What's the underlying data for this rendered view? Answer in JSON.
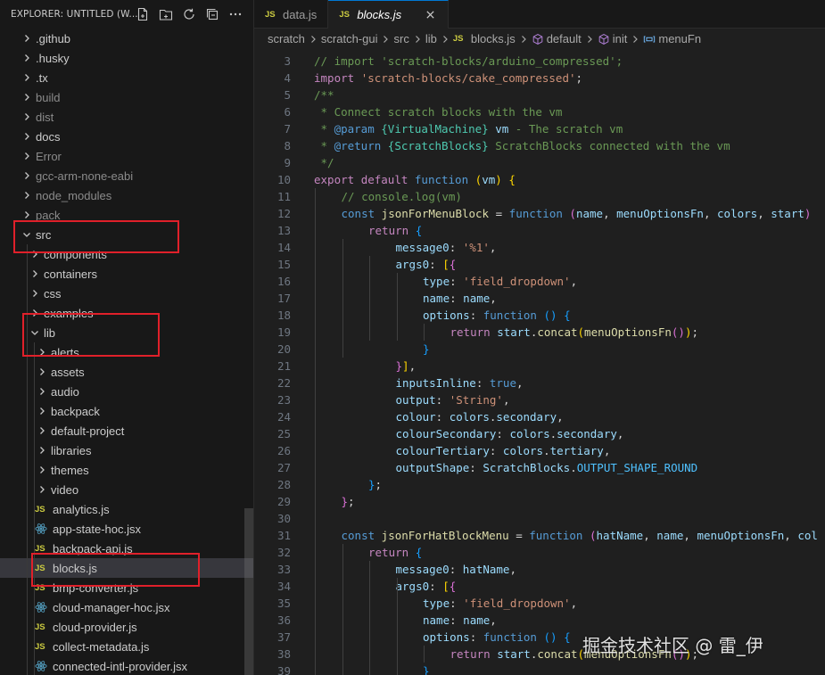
{
  "sidebar": {
    "title": "EXPLORER: UNTITLED (W...",
    "header_icons": [
      "new-file-icon",
      "new-folder-icon",
      "refresh-icon",
      "collapse-all-icon",
      "more-icon"
    ],
    "tree": [
      {
        "label": ".github",
        "type": "folder",
        "expanded": false,
        "dim": false
      },
      {
        "label": ".husky",
        "type": "folder",
        "expanded": false,
        "dim": false
      },
      {
        "label": ".tx",
        "type": "folder",
        "expanded": false,
        "dim": false
      },
      {
        "label": "build",
        "type": "folder",
        "expanded": false,
        "dim": true
      },
      {
        "label": "dist",
        "type": "folder",
        "expanded": false,
        "dim": true
      },
      {
        "label": "docs",
        "type": "folder",
        "expanded": false,
        "dim": false
      },
      {
        "label": "Error",
        "type": "folder",
        "expanded": false,
        "dim": true
      },
      {
        "label": "gcc-arm-none-eabi",
        "type": "folder",
        "expanded": false,
        "dim": true
      },
      {
        "label": "node_modules",
        "type": "folder",
        "expanded": false,
        "dim": true
      },
      {
        "label": "pack",
        "type": "folder",
        "expanded": false,
        "dim": true
      },
      {
        "label": "src",
        "type": "folder",
        "expanded": true,
        "dim": false
      },
      {
        "label": "components",
        "type": "folder",
        "expanded": false,
        "dim": false
      },
      {
        "label": "containers",
        "type": "folder",
        "expanded": false,
        "dim": false
      },
      {
        "label": "css",
        "type": "folder",
        "expanded": false,
        "dim": false
      },
      {
        "label": "examples",
        "type": "folder",
        "expanded": false,
        "dim": false
      },
      {
        "label": "lib",
        "type": "folder",
        "expanded": true,
        "dim": false
      },
      {
        "label": "alerts",
        "type": "folder",
        "expanded": false,
        "dim": false
      },
      {
        "label": "assets",
        "type": "folder",
        "expanded": false,
        "dim": false
      },
      {
        "label": "audio",
        "type": "folder",
        "expanded": false,
        "dim": false
      },
      {
        "label": "backpack",
        "type": "folder",
        "expanded": false,
        "dim": false
      },
      {
        "label": "default-project",
        "type": "folder",
        "expanded": false,
        "dim": false
      },
      {
        "label": "libraries",
        "type": "folder",
        "expanded": false,
        "dim": false
      },
      {
        "label": "themes",
        "type": "folder",
        "expanded": false,
        "dim": false
      },
      {
        "label": "video",
        "type": "folder",
        "expanded": false,
        "dim": false
      },
      {
        "label": "analytics.js",
        "type": "js",
        "dim": false
      },
      {
        "label": "app-state-hoc.jsx",
        "type": "jsx",
        "dim": false
      },
      {
        "label": "backpack-api.js",
        "type": "js",
        "dim": false
      },
      {
        "label": "blocks.js",
        "type": "js",
        "dim": false,
        "selected": true
      },
      {
        "label": "bmp-converter.js",
        "type": "js",
        "dim": false
      },
      {
        "label": "cloud-manager-hoc.jsx",
        "type": "jsx",
        "dim": false
      },
      {
        "label": "cloud-provider.js",
        "type": "js",
        "dim": false
      },
      {
        "label": "collect-metadata.js",
        "type": "js",
        "dim": false
      },
      {
        "label": "connected-intl-provider.jsx",
        "type": "jsx",
        "dim": false
      }
    ]
  },
  "tabs": [
    {
      "label": "data.js",
      "icon": "JS",
      "active": false
    },
    {
      "label": "blocks.js",
      "icon": "JS",
      "active": true
    }
  ],
  "breadcrumb": [
    {
      "label": "scratch",
      "icon": ""
    },
    {
      "label": "scratch-gui",
      "icon": ""
    },
    {
      "label": "src",
      "icon": ""
    },
    {
      "label": "lib",
      "icon": ""
    },
    {
      "label": "blocks.js",
      "icon": "JS"
    },
    {
      "label": "default",
      "icon": "cube-icon"
    },
    {
      "label": "init",
      "icon": "cube-icon"
    },
    {
      "label": "menuFn",
      "icon": "variable-icon"
    }
  ],
  "code": [
    {
      "n": "3",
      "indent": 0,
      "tokens": [
        [
          "com",
          "// import 'scratch-blocks/arduino_compressed';"
        ]
      ]
    },
    {
      "n": "4",
      "indent": 0,
      "tokens": [
        [
          "ctl",
          "import"
        ],
        [
          "pl",
          " "
        ],
        [
          "str",
          "'scratch-blocks/cake_compressed'"
        ],
        [
          "pl",
          ";"
        ]
      ]
    },
    {
      "n": "5",
      "indent": 0,
      "tokens": [
        [
          "com",
          "/**"
        ]
      ]
    },
    {
      "n": "6",
      "indent": 0,
      "tokens": [
        [
          "com",
          " * Connect scratch blocks with the vm"
        ]
      ]
    },
    {
      "n": "7",
      "indent": 0,
      "tokens": [
        [
          "com",
          " * "
        ],
        [
          "kw",
          "@param"
        ],
        [
          "com",
          " "
        ],
        [
          "cls",
          "{VirtualMachine}"
        ],
        [
          "com",
          " "
        ],
        [
          "var",
          "vm"
        ],
        [
          "com",
          " - The scratch vm"
        ]
      ]
    },
    {
      "n": "8",
      "indent": 0,
      "tokens": [
        [
          "com",
          " * "
        ],
        [
          "kw",
          "@return"
        ],
        [
          "com",
          " "
        ],
        [
          "cls",
          "{ScratchBlocks}"
        ],
        [
          "com",
          " ScratchBlocks connected with the vm"
        ]
      ]
    },
    {
      "n": "9",
      "indent": 0,
      "tokens": [
        [
          "com",
          " */"
        ]
      ]
    },
    {
      "n": "10",
      "indent": 0,
      "tokens": [
        [
          "ctl",
          "export"
        ],
        [
          "pl",
          " "
        ],
        [
          "ctl",
          "default"
        ],
        [
          "pl",
          " "
        ],
        [
          "kw",
          "function"
        ],
        [
          "pl",
          " "
        ],
        [
          "br1",
          "("
        ],
        [
          "var",
          "vm"
        ],
        [
          "br1",
          ")"
        ],
        [
          "pl",
          " "
        ],
        [
          "br1",
          "{"
        ]
      ]
    },
    {
      "n": "11",
      "indent": 1,
      "tokens": [
        [
          "com",
          "// console.log(vm)"
        ]
      ]
    },
    {
      "n": "12",
      "indent": 1,
      "tokens": [
        [
          "kw",
          "const"
        ],
        [
          "pl",
          " "
        ],
        [
          "fn",
          "jsonForMenuBlock"
        ],
        [
          "pl",
          " = "
        ],
        [
          "kw",
          "function"
        ],
        [
          "pl",
          " "
        ],
        [
          "br2",
          "("
        ],
        [
          "var",
          "name"
        ],
        [
          "pl",
          ", "
        ],
        [
          "var",
          "menuOptionsFn"
        ],
        [
          "pl",
          ", "
        ],
        [
          "var",
          "colors"
        ],
        [
          "pl",
          ", "
        ],
        [
          "var",
          "start"
        ],
        [
          "br2",
          ")"
        ]
      ]
    },
    {
      "n": "13",
      "indent": 2,
      "tokens": [
        [
          "ctl",
          "return"
        ],
        [
          "pl",
          " "
        ],
        [
          "br3",
          "{"
        ]
      ]
    },
    {
      "n": "14",
      "indent": 3,
      "tokens": [
        [
          "var",
          "message0"
        ],
        [
          "pl",
          ": "
        ],
        [
          "str",
          "'%1'"
        ],
        [
          "pl",
          ","
        ]
      ]
    },
    {
      "n": "15",
      "indent": 3,
      "tokens": [
        [
          "var",
          "args0"
        ],
        [
          "pl",
          ": "
        ],
        [
          "br1",
          "["
        ],
        [
          "br2",
          "{"
        ]
      ]
    },
    {
      "n": "16",
      "indent": 4,
      "tokens": [
        [
          "var",
          "type"
        ],
        [
          "pl",
          ": "
        ],
        [
          "str",
          "'field_dropdown'"
        ],
        [
          "pl",
          ","
        ]
      ]
    },
    {
      "n": "17",
      "indent": 4,
      "tokens": [
        [
          "var",
          "name"
        ],
        [
          "pl",
          ": "
        ],
        [
          "var",
          "name"
        ],
        [
          "pl",
          ","
        ]
      ]
    },
    {
      "n": "18",
      "indent": 4,
      "tokens": [
        [
          "var",
          "options"
        ],
        [
          "pl",
          ": "
        ],
        [
          "kw",
          "function"
        ],
        [
          "pl",
          " "
        ],
        [
          "br3",
          "()"
        ],
        [
          "pl",
          " "
        ],
        [
          "br3",
          "{"
        ]
      ]
    },
    {
      "n": "19",
      "indent": 5,
      "tokens": [
        [
          "ctl",
          "return"
        ],
        [
          "pl",
          " "
        ],
        [
          "var",
          "start"
        ],
        [
          "pl",
          "."
        ],
        [
          "fn",
          "concat"
        ],
        [
          "br1",
          "("
        ],
        [
          "fn",
          "menuOptionsFn"
        ],
        [
          "br2",
          "()"
        ],
        [
          "br1",
          ")"
        ],
        [
          "pl",
          ";"
        ]
      ]
    },
    {
      "n": "20",
      "indent": 4,
      "tokens": [
        [
          "br3",
          "}"
        ]
      ]
    },
    {
      "n": "21",
      "indent": 3,
      "tokens": [
        [
          "br2",
          "}"
        ],
        [
          "br1",
          "]"
        ],
        [
          "pl",
          ","
        ]
      ]
    },
    {
      "n": "22",
      "indent": 3,
      "tokens": [
        [
          "var",
          "inputsInline"
        ],
        [
          "pl",
          ": "
        ],
        [
          "kw",
          "true"
        ],
        [
          "pl",
          ","
        ]
      ]
    },
    {
      "n": "23",
      "indent": 3,
      "tokens": [
        [
          "var",
          "output"
        ],
        [
          "pl",
          ": "
        ],
        [
          "str",
          "'String'"
        ],
        [
          "pl",
          ","
        ]
      ]
    },
    {
      "n": "24",
      "indent": 3,
      "tokens": [
        [
          "var",
          "colour"
        ],
        [
          "pl",
          ": "
        ],
        [
          "var",
          "colors"
        ],
        [
          "pl",
          "."
        ],
        [
          "var",
          "secondary"
        ],
        [
          "pl",
          ","
        ]
      ]
    },
    {
      "n": "25",
      "indent": 3,
      "tokens": [
        [
          "var",
          "colourSecondary"
        ],
        [
          "pl",
          ": "
        ],
        [
          "var",
          "colors"
        ],
        [
          "pl",
          "."
        ],
        [
          "var",
          "secondary"
        ],
        [
          "pl",
          ","
        ]
      ]
    },
    {
      "n": "26",
      "indent": 3,
      "tokens": [
        [
          "var",
          "colourTertiary"
        ],
        [
          "pl",
          ": "
        ],
        [
          "var",
          "colors"
        ],
        [
          "pl",
          "."
        ],
        [
          "var",
          "tertiary"
        ],
        [
          "pl",
          ","
        ]
      ]
    },
    {
      "n": "27",
      "indent": 3,
      "tokens": [
        [
          "var",
          "outputShape"
        ],
        [
          "pl",
          ": "
        ],
        [
          "var",
          "ScratchBlocks"
        ],
        [
          "pl",
          "."
        ],
        [
          "const",
          "OUTPUT_SHAPE_ROUND"
        ]
      ]
    },
    {
      "n": "28",
      "indent": 2,
      "tokens": [
        [
          "br3",
          "}"
        ],
        [
          "pl",
          ";"
        ]
      ]
    },
    {
      "n": "29",
      "indent": 1,
      "tokens": [
        [
          "br2",
          "}"
        ],
        [
          "pl",
          ";"
        ]
      ]
    },
    {
      "n": "30",
      "indent": 0,
      "tokens": []
    },
    {
      "n": "31",
      "indent": 1,
      "tokens": [
        [
          "kw",
          "const"
        ],
        [
          "pl",
          " "
        ],
        [
          "fn",
          "jsonForHatBlockMenu"
        ],
        [
          "pl",
          " = "
        ],
        [
          "kw",
          "function"
        ],
        [
          "pl",
          " "
        ],
        [
          "br2",
          "("
        ],
        [
          "var",
          "hatName"
        ],
        [
          "pl",
          ", "
        ],
        [
          "var",
          "name"
        ],
        [
          "pl",
          ", "
        ],
        [
          "var",
          "menuOptionsFn"
        ],
        [
          "pl",
          ", "
        ],
        [
          "var",
          "col"
        ]
      ]
    },
    {
      "n": "32",
      "indent": 2,
      "tokens": [
        [
          "ctl",
          "return"
        ],
        [
          "pl",
          " "
        ],
        [
          "br3",
          "{"
        ]
      ]
    },
    {
      "n": "33",
      "indent": 3,
      "tokens": [
        [
          "var",
          "message0"
        ],
        [
          "pl",
          ": "
        ],
        [
          "var",
          "hatName"
        ],
        [
          "pl",
          ","
        ]
      ]
    },
    {
      "n": "34",
      "indent": 3,
      "tokens": [
        [
          "var",
          "args0"
        ],
        [
          "pl",
          ": "
        ],
        [
          "br1",
          "["
        ],
        [
          "br2",
          "{"
        ]
      ]
    },
    {
      "n": "35",
      "indent": 4,
      "tokens": [
        [
          "var",
          "type"
        ],
        [
          "pl",
          ": "
        ],
        [
          "str",
          "'field_dropdown'"
        ],
        [
          "pl",
          ","
        ]
      ]
    },
    {
      "n": "36",
      "indent": 4,
      "tokens": [
        [
          "var",
          "name"
        ],
        [
          "pl",
          ": "
        ],
        [
          "var",
          "name"
        ],
        [
          "pl",
          ","
        ]
      ]
    },
    {
      "n": "37",
      "indent": 4,
      "tokens": [
        [
          "var",
          "options"
        ],
        [
          "pl",
          ": "
        ],
        [
          "kw",
          "function"
        ],
        [
          "pl",
          " "
        ],
        [
          "br3",
          "()"
        ],
        [
          "pl",
          " "
        ],
        [
          "br3",
          "{"
        ]
      ]
    },
    {
      "n": "38",
      "indent": 5,
      "tokens": [
        [
          "ctl",
          "return"
        ],
        [
          "pl",
          " "
        ],
        [
          "var",
          "start"
        ],
        [
          "pl",
          "."
        ],
        [
          "fn",
          "concat"
        ],
        [
          "br1",
          "("
        ],
        [
          "fn",
          "menuOptionsFn"
        ],
        [
          "br2",
          "()"
        ],
        [
          "br1",
          ")"
        ],
        [
          "pl",
          ";"
        ]
      ]
    },
    {
      "n": "39",
      "indent": 4,
      "tokens": [
        [
          "br3",
          "}"
        ]
      ]
    }
  ],
  "watermark": "掘金技术社区 @ 雷_伊",
  "colors": {
    "highlight_box": "#e0202a",
    "selection": "#37373d",
    "js_icon": "#cbcb41"
  }
}
